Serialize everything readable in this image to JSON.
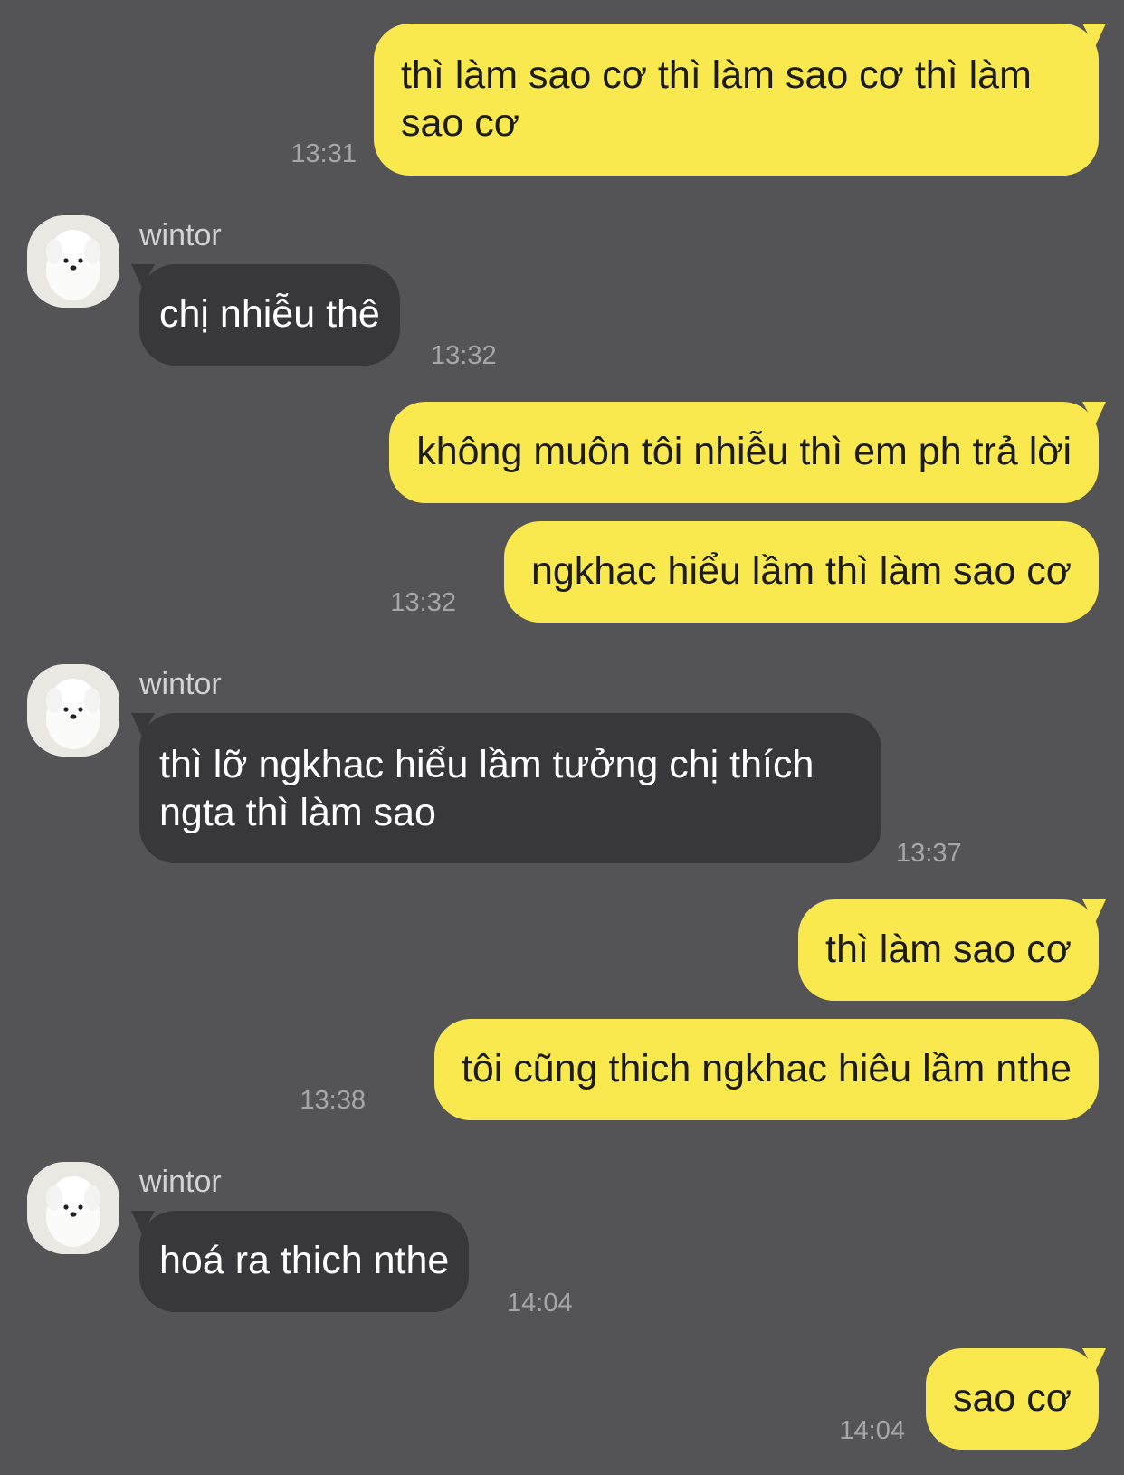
{
  "contact": {
    "name": "wintor",
    "avatar_icon": "white-puppy-avatar-icon"
  },
  "colors": {
    "background": "#545356",
    "outgoing": "#fae84f",
    "incoming": "#38383a",
    "timestamp": "#a6a5a8"
  },
  "messages": [
    {
      "direction": "out",
      "text": "thì làm sao cơ thì làm sao cơ thì làm sao cơ",
      "time": "13:31"
    },
    {
      "direction": "in",
      "sender": "wintor",
      "text": "chị nhiễu thê",
      "time": "13:32"
    },
    {
      "direction": "out",
      "text": "không muôn tôi nhiễu thì em ph trả lời",
      "time": ""
    },
    {
      "direction": "out",
      "text": "ngkhac hiểu lầm thì làm sao cơ",
      "time": "13:32"
    },
    {
      "direction": "in",
      "sender": "wintor",
      "text": "thì lỡ ngkhac hiểu lầm tưởng chị thích ngta thì làm sao",
      "time": "13:37"
    },
    {
      "direction": "out",
      "text": "thì làm sao cơ",
      "time": ""
    },
    {
      "direction": "out",
      "text": "tôi cũng thich ngkhac hiêu lầm nthe",
      "time": "13:38"
    },
    {
      "direction": "in",
      "sender": "wintor",
      "text": "hoá ra thich nthe",
      "time": "14:04"
    },
    {
      "direction": "out",
      "text": "sao cơ",
      "time": "14:04"
    }
  ]
}
